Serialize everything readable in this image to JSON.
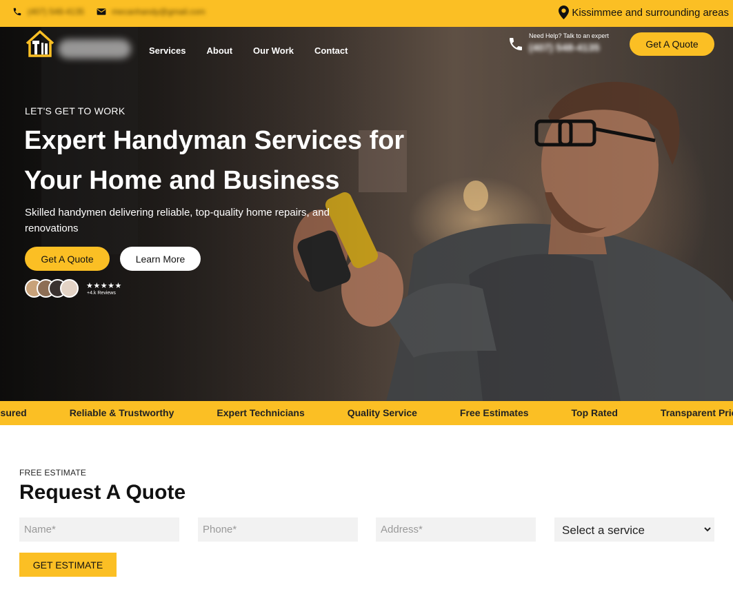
{
  "topbar": {
    "phone": "(407) 548-4135",
    "email": "mecanhandy@gmail.com",
    "location": "Kissimmee and surrounding areas"
  },
  "nav": {
    "links": [
      "Services",
      "About",
      "Our Work",
      "Contact"
    ],
    "help_text": "Need Help? Talk to an expert",
    "help_phone": "(407) 548-4135",
    "cta": "Get A Quote"
  },
  "hero": {
    "eyebrow": "LET'S GET TO WORK",
    "headline": "Expert Handyman Services for Your Home and Business",
    "subheadline": "Skilled handymen delivering reliable, top-quality home repairs, and renovations",
    "primary_cta": "Get A Quote",
    "secondary_cta": "Learn More",
    "rating_stars": "★★★★★",
    "reviews": "+4.k Reviews"
  },
  "ticker": [
    "nsured",
    "Reliable & Trustworthy",
    "Expert Technicians",
    "Quality Service",
    "Free Estimates",
    "Top Rated",
    "Transparent Pricin"
  ],
  "quote_form": {
    "eyebrow": "FREE ESTIMATE",
    "title": "Request A Quote",
    "name_placeholder": "Name*",
    "phone_placeholder": "Phone*",
    "address_placeholder": "Address*",
    "service_selected": "Select a service",
    "submit": "GET ESTIMATE"
  },
  "colors": {
    "accent": "#fbbf24",
    "text": "#111111",
    "field_bg": "#f2f2f2"
  },
  "icons": [
    "phone-icon",
    "mail-icon",
    "map-pin-icon",
    "house-tools-logo-icon",
    "chevron-down-icon"
  ]
}
